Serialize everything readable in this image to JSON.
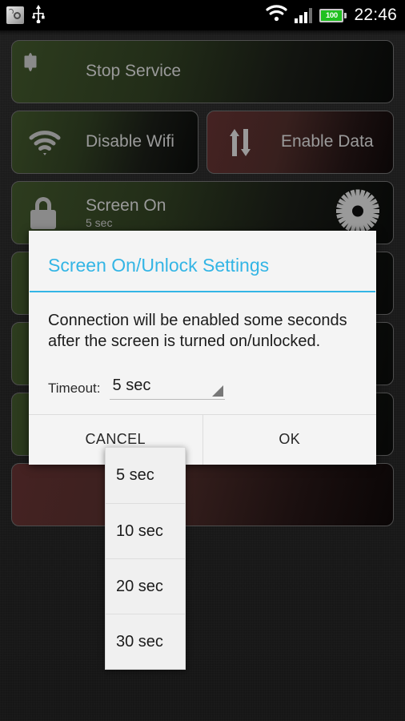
{
  "statusbar": {
    "app_icon": "app-settings-icon",
    "usb_icon": "usb-icon",
    "wifi_icon": "wifi-icon",
    "signal_icon": "cellular-signal-icon",
    "battery_level": "100",
    "time": "22:46"
  },
  "tiles": [
    {
      "label": "Stop Service",
      "icon": "stop-icon",
      "color": "#2d3c1e",
      "sub": ""
    },
    {
      "label": "Disable Wifi",
      "icon": "wifi-icon",
      "color": "#2d3c1e",
      "sub": ""
    },
    {
      "label": "Enable Data",
      "icon": "data-transfer-icon",
      "color": "#452222",
      "sub": ""
    },
    {
      "label": "Screen On",
      "icon": "lock-icon",
      "color": "#2d3c1e",
      "sub": "5 sec",
      "gear": "gear-icon"
    }
  ],
  "dialog": {
    "title": "Screen On/Unlock Settings",
    "accent": "#33b5e5",
    "body": "Connection will be enabled some seconds after the screen is turned on/unlocked.",
    "timeout_label": "Timeout:",
    "timeout_value": "5 sec",
    "cancel_label": "CANCEL",
    "ok_label": "OK"
  },
  "dropdown": {
    "options": [
      {
        "label": "5 sec"
      },
      {
        "label": "10 sec"
      },
      {
        "label": "20 sec"
      },
      {
        "label": "30 sec"
      }
    ]
  }
}
